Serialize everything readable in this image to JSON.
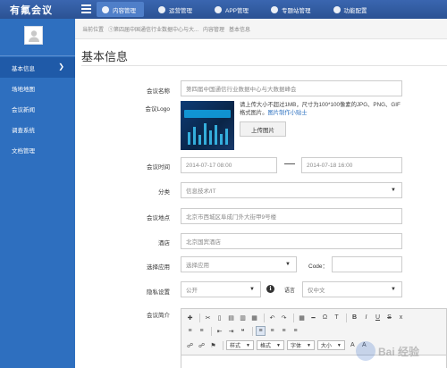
{
  "app": {
    "title": "有氟会议"
  },
  "topnav": [
    {
      "label": "内容管理",
      "active": true
    },
    {
      "label": "运营管理",
      "active": false
    },
    {
      "label": "APP管理",
      "active": false
    },
    {
      "label": "专题站管理",
      "active": false
    },
    {
      "label": "功能配置",
      "active": false
    }
  ],
  "sidebar": {
    "items": [
      {
        "label": "基本信息",
        "active": true
      },
      {
        "label": "场地地图",
        "active": false
      },
      {
        "label": "会议新闻",
        "active": false
      },
      {
        "label": "调查系统",
        "active": false
      },
      {
        "label": "文档管理",
        "active": false
      }
    ]
  },
  "breadcrumb": {
    "prefix": "当前位置",
    "items": [
      "①第四届中国通信行业数据中心与大...",
      "内容管理",
      "基本信息"
    ]
  },
  "page": {
    "title": "基本信息"
  },
  "form": {
    "name": {
      "label": "会议名称",
      "value": "第四届中国通信行业数据中心与大数据峰会"
    },
    "logo": {
      "label": "会议Logo",
      "hint": "请上传大小不超过1MB，尺寸为100*100像素的JPG、PNG、GIF格式图片。",
      "hint_link": "图片制作小贴士",
      "upload_label": "上传图片"
    },
    "time": {
      "label": "会议时间",
      "start": "2014-07-17 08:00",
      "end": "2014-07-18 16:00"
    },
    "category": {
      "label": "分类",
      "value": "信息技术/IT"
    },
    "location": {
      "label": "会议地点",
      "value": "北京市西城区阜成门外大街甲9号楼"
    },
    "hotel": {
      "label": "酒店",
      "value": "北京国宾酒店"
    },
    "app": {
      "label": "选择应用",
      "value": "选择应用",
      "code_label": "Code：",
      "code_value": ""
    },
    "privacy": {
      "label": "隐私设置",
      "value": "公开",
      "lang_label": "语言",
      "lang_value": "仅中文"
    },
    "intro": {
      "label": "会议简介"
    }
  },
  "editor": {
    "selects": [
      "样式",
      "格式",
      "字体",
      "大小"
    ]
  },
  "watermark": {
    "text": "Bai 经验"
  }
}
